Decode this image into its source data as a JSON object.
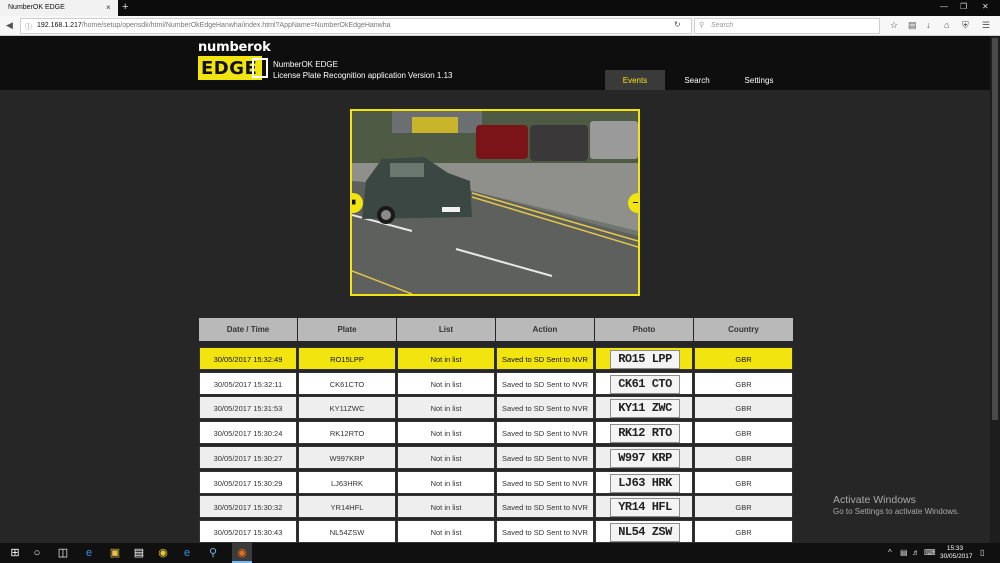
{
  "browser": {
    "tab_title": "NumberOK EDGE",
    "tab_close": "×",
    "new_tab": "+",
    "url_host": "192.168.1.217",
    "url_path": "/home/setup/opensdk/html/NumberOkEdgeHanwha/index.html?AppName=NumberOkEdgeHanwha",
    "search_placeholder": "Search",
    "window_controls": [
      "—",
      "❐",
      "✕"
    ],
    "toolbar_icons": [
      "star-icon",
      "clipboard-icon",
      "download-icon",
      "home-icon",
      "shield-icon",
      "menu-icon"
    ]
  },
  "app": {
    "logo_top": "numberok",
    "logo_edge": "EDGE",
    "name": "NumberOK EDGE",
    "subtitle": "License Plate Recognition application",
    "version": "Version 1.13",
    "nav": [
      "Events",
      "Search",
      "Settings"
    ],
    "active_nav": "Events",
    "accent_color": "#f2e40f"
  },
  "table": {
    "headers": [
      "Date / Time",
      "Plate",
      "List",
      "Action",
      "Photo",
      "Country"
    ],
    "rows": [
      {
        "datetime": "30/05/2017 15:32:49",
        "plate": "RO15LPP",
        "list": "Not in list",
        "action": "Saved to SD Sent to NVR",
        "photo": "RO15 LPP",
        "country": "GBR"
      },
      {
        "datetime": "30/05/2017 15:32:11",
        "plate": "CK61CTO",
        "list": "Not in list",
        "action": "Saved to SD Sent to NVR",
        "photo": "CK61 CTO",
        "country": "GBR"
      },
      {
        "datetime": "30/05/2017 15:31:53",
        "plate": "KY11ZWC",
        "list": "Not in list",
        "action": "Saved to SD Sent to NVR",
        "photo": "KY11 ZWC",
        "country": "GBR"
      },
      {
        "datetime": "30/05/2017 15:30:24",
        "plate": "RK12RTO",
        "list": "Not in list",
        "action": "Saved to SD Sent to NVR",
        "photo": "RK12 RTO",
        "country": "GBR"
      },
      {
        "datetime": "30/05/2017 15:30:27",
        "plate": "W997KRP",
        "list": "Not in list",
        "action": "Saved to SD Sent to NVR",
        "photo": "W997 KRP",
        "country": "GBR"
      },
      {
        "datetime": "30/05/2017 15:30:29",
        "plate": "LJ63HRK",
        "list": "Not in list",
        "action": "Saved to SD Sent to NVR",
        "photo": "LJ63 HRK",
        "country": "GBR"
      },
      {
        "datetime": "30/05/2017 15:30:32",
        "plate": "YR14HFL",
        "list": "Not in list",
        "action": "Saved to SD Sent to NVR",
        "photo": "YR14 HFL",
        "country": "GBR"
      },
      {
        "datetime": "30/05/2017 15:30:43",
        "plate": "NL54ZSW",
        "list": "Not in list",
        "action": "Saved to SD Sent to NVR",
        "photo": "NL54 ZSW",
        "country": "GBR"
      }
    ]
  },
  "watermark": {
    "title": "Activate Windows",
    "subtitle": "Go to Settings to activate Windows."
  },
  "taskbar": {
    "time": "15:33",
    "date": "30/05/2017"
  }
}
